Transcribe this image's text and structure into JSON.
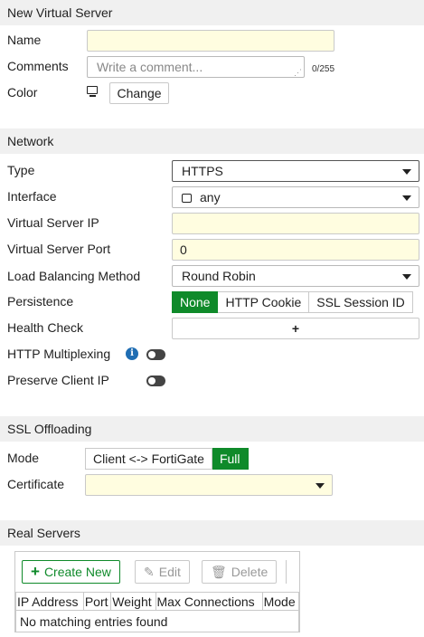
{
  "sections": {
    "general": "New Virtual Server",
    "network": "Network",
    "ssl": "SSL Offloading",
    "real_servers": "Real Servers"
  },
  "general": {
    "name_label": "Name",
    "name_value": "",
    "comments_label": "Comments",
    "comments_placeholder": "Write a comment...",
    "comments_counter": "0/255",
    "color_label": "Color",
    "color_change": "Change"
  },
  "network": {
    "type_label": "Type",
    "type_value": "HTTPS",
    "interface_label": "Interface",
    "interface_value": "any",
    "vip_label": "Virtual Server IP",
    "vip_value": "",
    "port_label": "Virtual Server Port",
    "port_value": "0",
    "lb_label": "Load Balancing Method",
    "lb_value": "Round Robin",
    "persistence_label": "Persistence",
    "persistence_options": [
      "None",
      "HTTP Cookie",
      "SSL Session ID"
    ],
    "persistence_selected": "None",
    "health_label": "Health Check",
    "health_add": "+",
    "multiplex_label": "HTTP Multiplexing",
    "multiplex_info": "i",
    "preserve_label": "Preserve Client IP"
  },
  "ssl": {
    "mode_label": "Mode",
    "mode_options": [
      "Client <-> FortiGate",
      "Full"
    ],
    "mode_selected": "Full",
    "cert_label": "Certificate",
    "cert_value": ""
  },
  "real_servers": {
    "create_new": "Create New",
    "edit": "Edit",
    "delete": "Delete",
    "columns": [
      "IP Address",
      "Port",
      "Weight",
      "Max Connections",
      "Mode"
    ],
    "empty_message": "No matching entries found"
  },
  "colors": {
    "accent_green": "#0f8a2a",
    "input_yellow": "#fffde0",
    "section_bg": "#f0f0f0",
    "info_blue": "#1f6db3"
  }
}
